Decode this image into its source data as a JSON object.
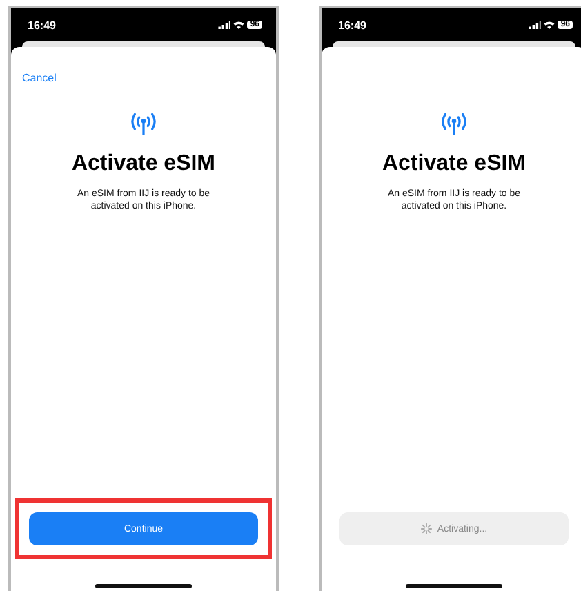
{
  "screens": [
    {
      "status_bar": {
        "time": "16:49",
        "battery": "96"
      },
      "cancel": "Cancel",
      "title": "Activate eSIM",
      "message": "An eSIM from IIJ is ready to be activated on this iPhone.",
      "action": {
        "kind": "button",
        "label": "Continue",
        "highlighted": true
      }
    },
    {
      "status_bar": {
        "time": "16:49",
        "battery": "96"
      },
      "title": "Activate eSIM",
      "message": "An eSIM from IIJ is ready to be activated on this iPhone.",
      "action": {
        "kind": "progress",
        "label": "Activating..."
      }
    }
  ]
}
